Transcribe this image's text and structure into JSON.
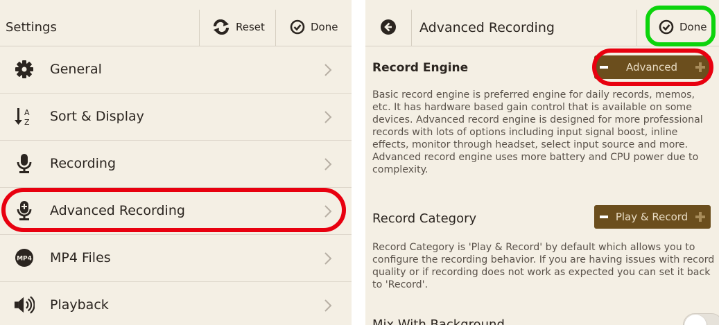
{
  "left": {
    "header": {
      "title": "Settings",
      "reset_label": "Reset",
      "done_label": "Done"
    },
    "menu": [
      {
        "label": "General",
        "icon": "gear-icon"
      },
      {
        "label": "Sort & Display",
        "icon": "sort-az-icon"
      },
      {
        "label": "Recording",
        "icon": "microphone-icon"
      },
      {
        "label": "Advanced Recording",
        "icon": "microphone-plus-icon",
        "highlighted": true
      },
      {
        "label": "MP4 Files",
        "icon": "mp4-icon",
        "icon_text": "MP4"
      },
      {
        "label": "Playback",
        "icon": "speaker-icon"
      }
    ]
  },
  "right": {
    "header": {
      "title": "Advanced Recording",
      "done_label": "Done"
    },
    "record_engine": {
      "title": "Record Engine",
      "value": "Advanced",
      "description": "Basic record engine is preferred engine for daily records, memos, etc. It has hardware based gain control that is available on some devices. Advanced record engine is designed for more professional records with lots of options including input signal boost, inline effects, monitor through headset, select input source and more. Advanced record engine uses more battery and CPU power due to complexity."
    },
    "record_category": {
      "title": "Record Category",
      "value": "Play & Record",
      "description": "Record Category is 'Play & Record' by default which allows you to configure the recording behavior. If you are having issues with record quality or if recording does not work as expected you can set it back to 'Record'."
    },
    "mix_with_background": {
      "title": "Mix With Background",
      "enabled": false
    }
  },
  "colors": {
    "background": "#f4efe4",
    "stepper": "#6b4e1d",
    "highlight_red": "#e8000f",
    "highlight_green": "#0cd40c"
  }
}
